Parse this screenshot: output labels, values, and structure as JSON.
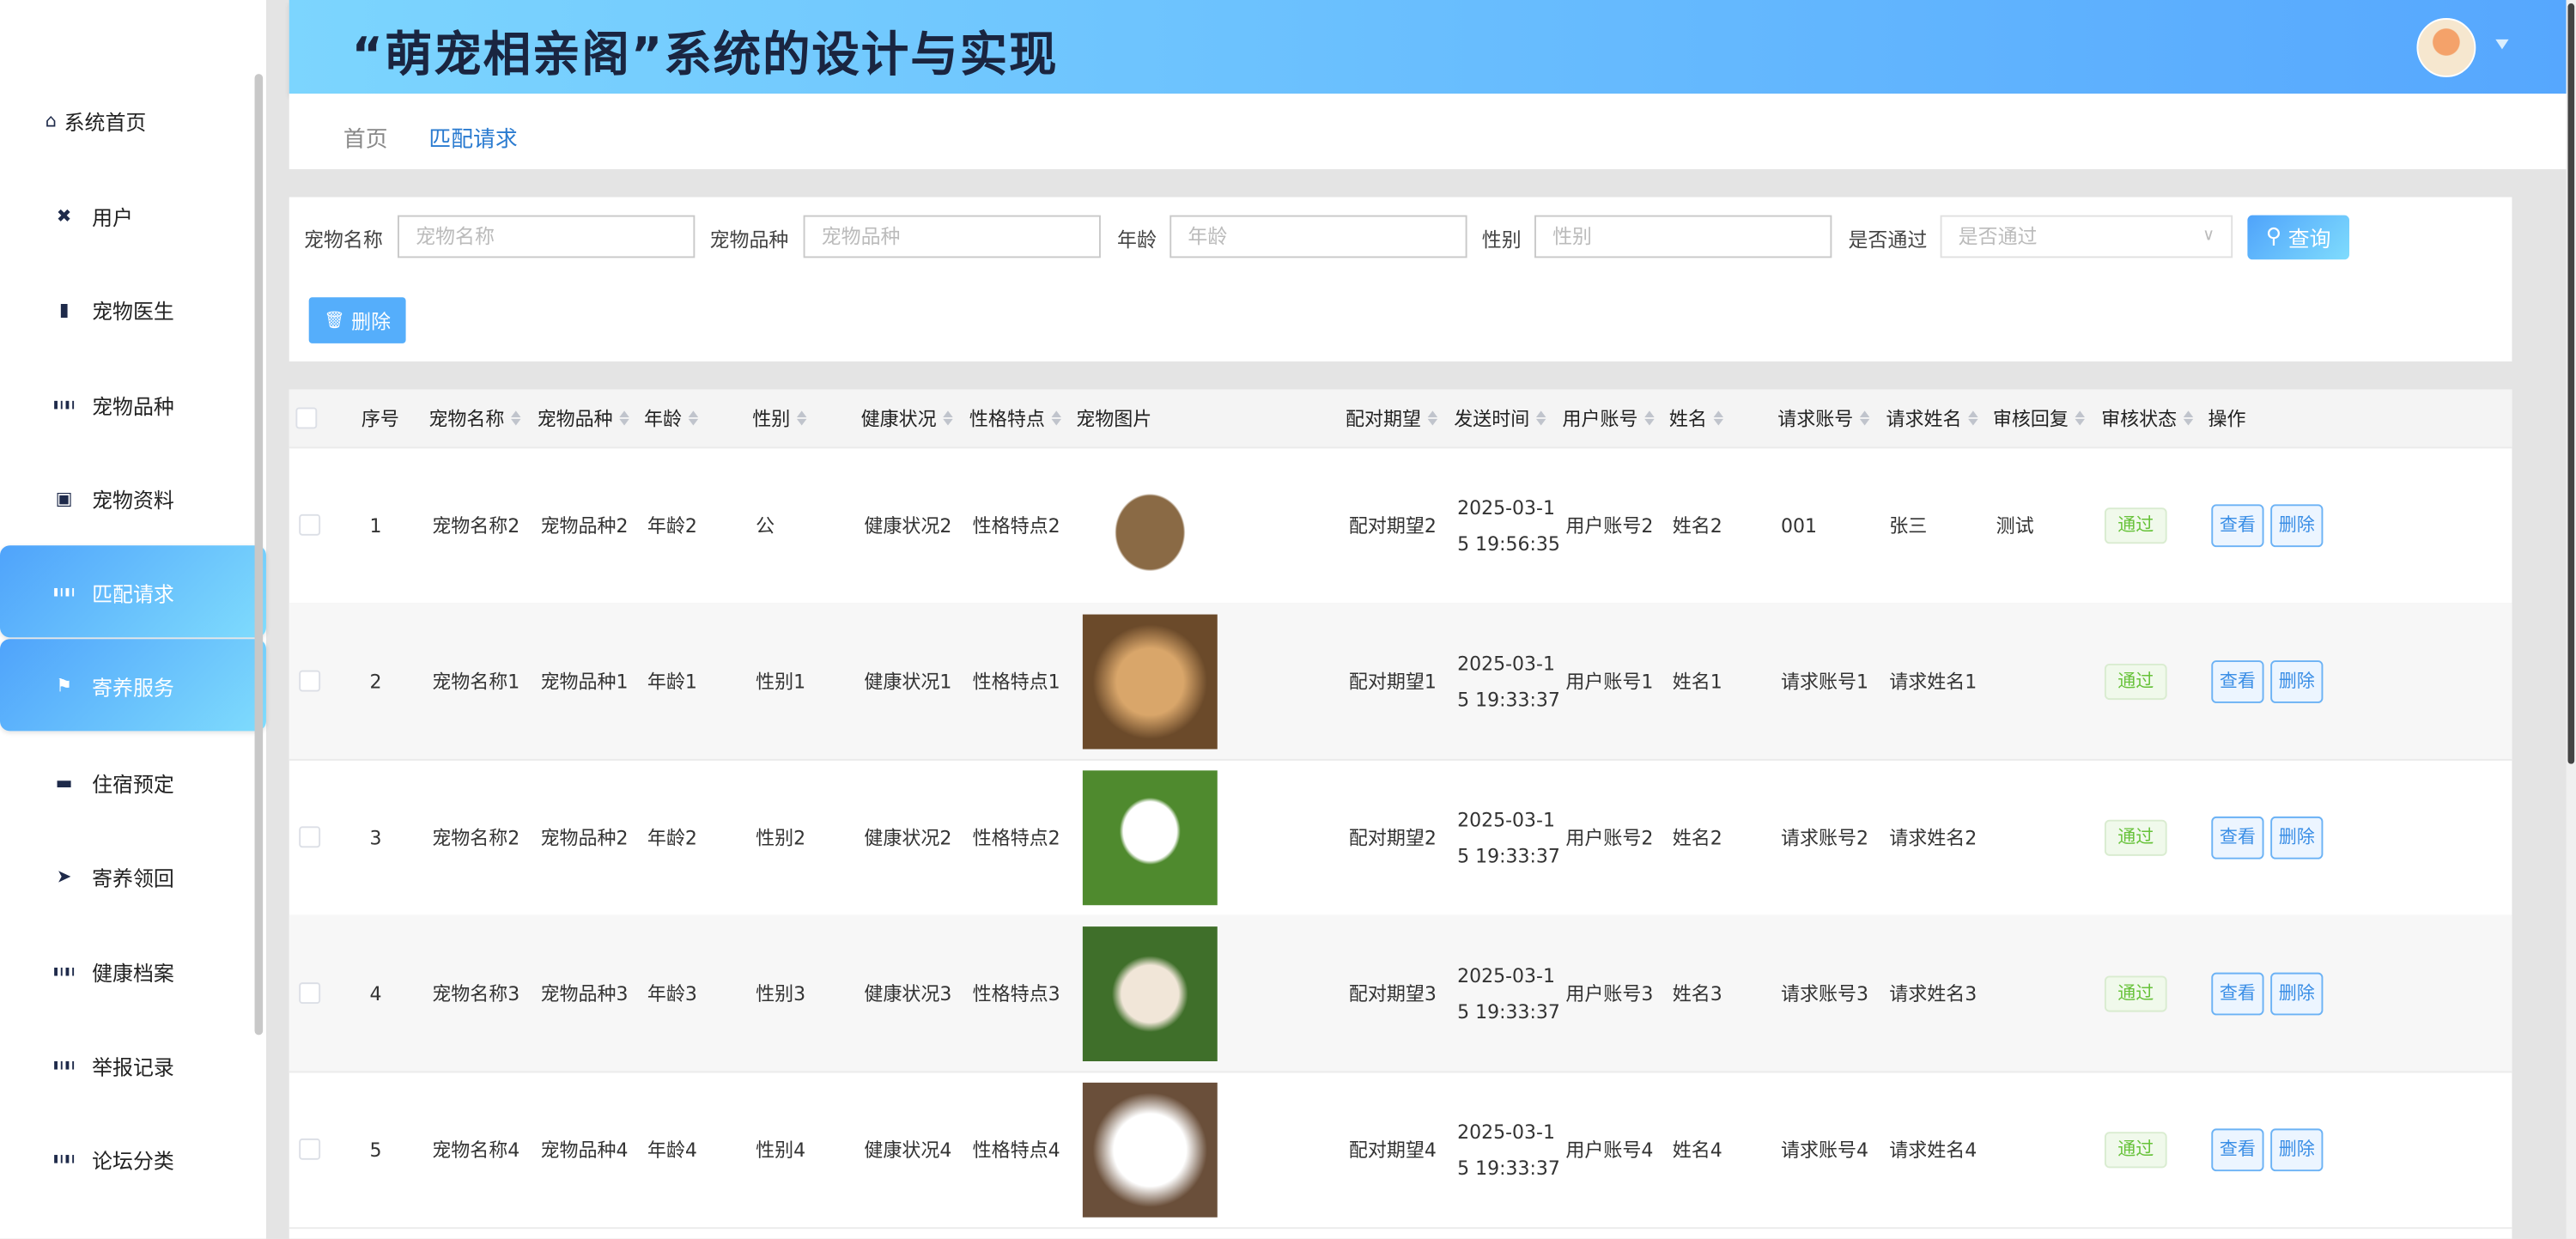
{
  "header": {
    "title": "“萌宠相亲阁”系统的设计与实现"
  },
  "breadcrumb": {
    "home": "首页",
    "current": "匹配请求"
  },
  "sidebar": {
    "items": [
      {
        "label": "系统首页",
        "icon": "home-icon"
      },
      {
        "label": "用户",
        "icon": "user-icon"
      },
      {
        "label": "宠物医生",
        "icon": "doctor-icon"
      },
      {
        "label": "宠物品种",
        "icon": "grid-icon"
      },
      {
        "label": "宠物资料",
        "icon": "clipboard-icon"
      },
      {
        "label": "匹配请求",
        "icon": "grid-icon",
        "active": true
      },
      {
        "label": "寄养服务",
        "icon": "flag-icon",
        "hover": true
      },
      {
        "label": "住宿预定",
        "icon": "bed-icon"
      },
      {
        "label": "寄养领回",
        "icon": "send-icon"
      },
      {
        "label": "健康档案",
        "icon": "grid-icon"
      },
      {
        "label": "举报记录",
        "icon": "grid-icon"
      },
      {
        "label": "论坛分类",
        "icon": "grid-icon"
      }
    ]
  },
  "search": {
    "name_label": "宠物名称",
    "name_placeholder": "宠物名称",
    "breed_label": "宠物品种",
    "breed_placeholder": "宠物品种",
    "age_label": "年龄",
    "age_placeholder": "年龄",
    "gender_label": "性别",
    "gender_placeholder": "性别",
    "pass_label": "是否通过",
    "pass_placeholder": "是否通过",
    "query_button": "查询",
    "delete_button": "删除"
  },
  "table": {
    "columns": [
      "序号",
      "宠物名称",
      "宠物品种",
      "年龄",
      "性别",
      "健康状况",
      "性格特点",
      "宠物图片",
      "配对期望",
      "发送时间",
      "用户账号",
      "姓名",
      "请求账号",
      "请求姓名",
      "审核回复",
      "审核状态",
      "操作"
    ],
    "view_label": "查看",
    "delete_label": "删除",
    "rows": [
      {
        "seq": "1",
        "name": "宠物名称2",
        "breed": "宠物品种2",
        "age": "年龄2",
        "gender": "公",
        "health": "健康状况2",
        "trait": "性格特点2",
        "image": "ferret",
        "expect": "配对期望2",
        "time": "2025-03-15 19:56:35",
        "account": "用户账号2",
        "uname": "姓名2",
        "req_account": "001",
        "req_name": "张三",
        "reply": "测试",
        "status": "通过"
      },
      {
        "seq": "2",
        "name": "宠物名称1",
        "breed": "宠物品种1",
        "age": "年龄1",
        "gender": "性别1",
        "health": "健康状况1",
        "trait": "性格特点1",
        "image": "golden-puppy",
        "expect": "配对期望1",
        "time": "2025-03-15 19:33:37",
        "account": "用户账号1",
        "uname": "姓名1",
        "req_account": "请求账号1",
        "req_name": "请求姓名1",
        "reply": "",
        "status": "通过"
      },
      {
        "seq": "3",
        "name": "宠物名称2",
        "breed": "宠物品种2",
        "age": "年龄2",
        "gender": "性别2",
        "health": "健康状况2",
        "trait": "性格特点2",
        "image": "white-puppy-grass",
        "expect": "配对期望2",
        "time": "2025-03-15 19:33:37",
        "account": "用户账号2",
        "uname": "姓名2",
        "req_account": "请求账号2",
        "req_name": "请求姓名2",
        "reply": "",
        "status": "通过"
      },
      {
        "seq": "4",
        "name": "宠物名称3",
        "breed": "宠物品种3",
        "age": "年龄3",
        "gender": "性别3",
        "health": "健康状况3",
        "trait": "性格特点3",
        "image": "rabbits",
        "expect": "配对期望3",
        "time": "2025-03-15 19:33:37",
        "account": "用户账号3",
        "uname": "姓名3",
        "req_account": "请求账号3",
        "req_name": "请求姓名3",
        "reply": "",
        "status": "通过"
      },
      {
        "seq": "5",
        "name": "宠物名称4",
        "breed": "宠物品种4",
        "age": "年龄4",
        "gender": "性别4",
        "health": "健康状况4",
        "trait": "性格特点4",
        "image": "pomeranian",
        "expect": "配对期望4",
        "time": "2025-03-15 19:33:37",
        "account": "用户账号4",
        "uname": "姓名4",
        "req_account": "请求账号4",
        "req_name": "请求姓名4",
        "reply": "",
        "status": "通过"
      }
    ]
  },
  "colors": {
    "accent": "#56a7fe",
    "accent_light": "#7fdcfd",
    "success": "#67c23a",
    "title": "#1a2540"
  }
}
